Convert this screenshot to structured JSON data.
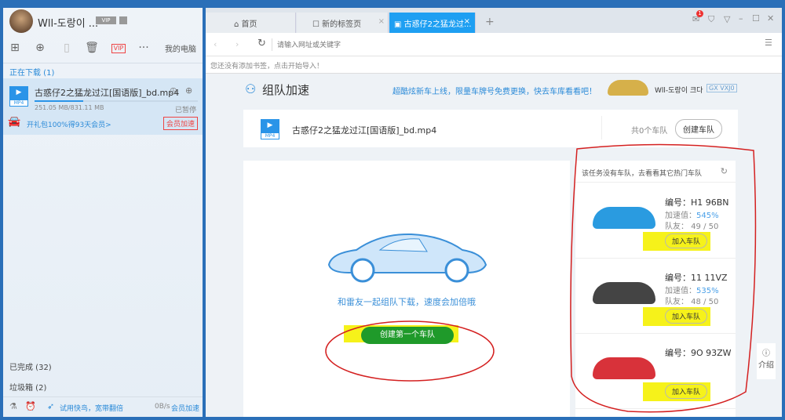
{
  "user": {
    "name": "Wll-도랑이 ...",
    "vip": "VIP"
  },
  "toolbar": {
    "my_pc": "我的电脑"
  },
  "left": {
    "downloading": "正在下载 (1)",
    "item": {
      "name": "古惑仔2之猛龙过江[国语版]_bd.mp4",
      "file_type": "MP4",
      "size": "251.05 MB/831.11 MB",
      "status": "已暂停",
      "progress": 0.3,
      "promo": "开礼包100%得93天会员>",
      "speed_button": "会员加速"
    },
    "completed": "已完成 (32)",
    "trash": "垃圾箱 (2)",
    "footer": {
      "trial": "试用快鸟，宽带翻倍",
      "speed": "0B/s",
      "vip_speed": "会员加速"
    }
  },
  "browser": {
    "tabs": [
      {
        "label": "首页"
      },
      {
        "label": "新的标签页"
      },
      {
        "label": "古惑仔2之猛龙过..."
      }
    ],
    "notification_count": "1",
    "address_placeholder": "请输入网址或关键字",
    "bookmark_hint": "您还没有添加书签，点击开始导入！"
  },
  "team": {
    "title": "组队加速",
    "banner": "超酷炫新车上线，限量车牌号免费更换，快去车库看看吧！",
    "user": "Wll-도랑이 크다",
    "plate": "GX VXJ0",
    "file": "古惑仔2之猛龙过江[国语版]_bd.mp4",
    "team_count": "共0个车队",
    "create_team": "创建车队",
    "slogan": "和雷友一起组队下载，速度会加倍哦",
    "create_first": "创建第一个车队",
    "hot_header": "该任务没有车队，去看看其它热门车队",
    "cars": [
      {
        "plate": "编号：H1 96BN",
        "boost_label": "加速值：",
        "boost": "545%",
        "members": "队友： 49 / 50",
        "join": "加入车队",
        "color": "#2a9be0"
      },
      {
        "plate": "编号：11 11VZ",
        "boost_label": "加速值：",
        "boost": "535%",
        "members": "队友： 48 / 50",
        "join": "加入车队",
        "color": "#444444"
      },
      {
        "plate": "编号：9O 93ZW",
        "join": "加入车队",
        "color": "#d8323a"
      }
    ],
    "intro": "介绍"
  }
}
